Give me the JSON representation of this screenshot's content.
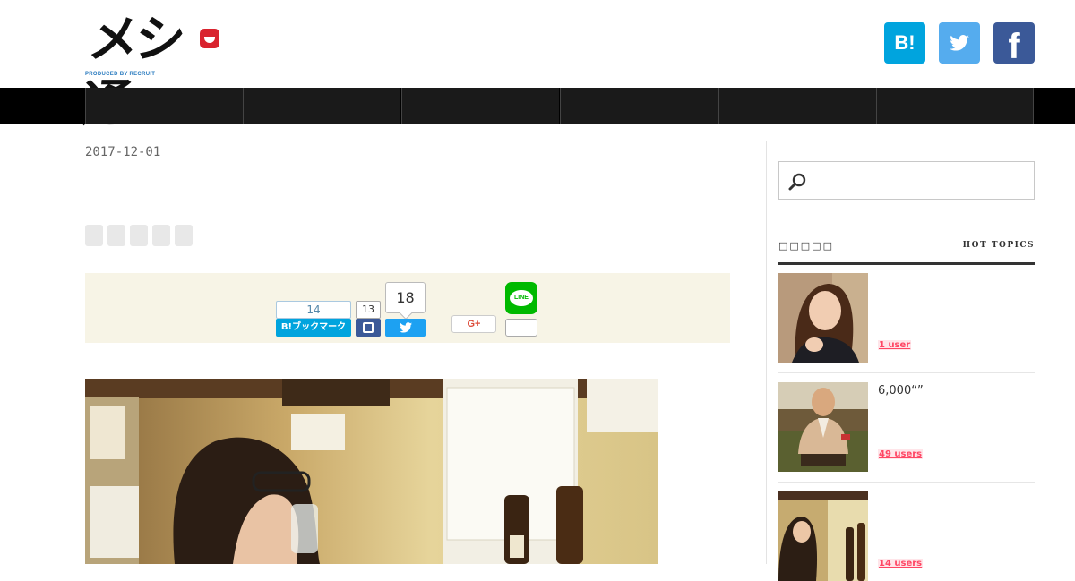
{
  "header": {
    "logo_text": "メシ通",
    "logo_produced_by": "PRODUCED BY ",
    "logo_brand": "RECRUIT",
    "social": {
      "hatena_label": "B!",
      "hatena_icon": "hatena-bookmark-icon",
      "twitter_icon": "twitter-bird-icon",
      "facebook_label": "f",
      "facebook_icon": "facebook-icon"
    }
  },
  "nav": {
    "item_count": 6,
    "background": "#1a1a1a"
  },
  "article": {
    "date": "2017-12-01",
    "tag_count": 5,
    "share": {
      "hatena_count": "14",
      "hatena_button_label": "B!ブックマーク",
      "facebook_count": "13",
      "twitter_count": "18",
      "googleplus_label": "G+",
      "line_label": "LINE",
      "line_count": ""
    }
  },
  "sidebar": {
    "search_placeholder": "",
    "hot_topics_heading_jp": "□□□□□",
    "hot_topics_heading": "HOT TOPICS",
    "topics": [
      {
        "title": "",
        "users": "1 user"
      },
      {
        "title": "6,000“”",
        "users": "49 users"
      },
      {
        "title": "",
        "users": "14 users"
      }
    ]
  },
  "colors": {
    "nav": "#000000",
    "hatena": "#00a4de",
    "twitter": "#55acee",
    "facebook": "#3b5998",
    "line": "#00b900",
    "share_bg": "#f7f4e6",
    "users_badge": "#ff4664"
  }
}
